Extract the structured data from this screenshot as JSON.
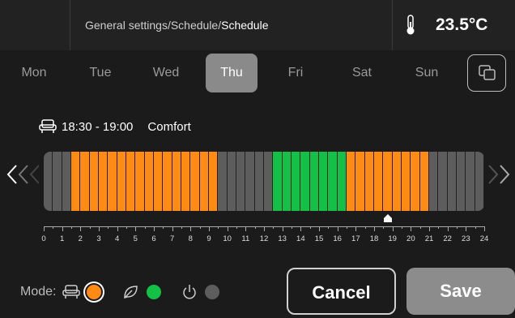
{
  "header": {
    "breadcrumb_path": "General settings/Schedule/",
    "breadcrumb_current": "Schedule",
    "temperature": "23.5°C"
  },
  "days": [
    "Mon",
    "Tue",
    "Wed",
    "Thu",
    "Fri",
    "Sat",
    "Sun"
  ],
  "active_day": "Thu",
  "selected_slot": {
    "time": "18:30 - 19:00",
    "mode": "Comfort"
  },
  "schedule": {
    "slots_per_day": 48,
    "comfort_ranges": [
      [
        1.5,
        9.5
      ],
      [
        16.5,
        21.0
      ]
    ],
    "eco_ranges": [
      [
        12.5,
        16.5
      ]
    ],
    "marker_hour": 18.75
  },
  "hours": [
    "0",
    "1",
    "2",
    "3",
    "4",
    "5",
    "6",
    "7",
    "8",
    "9",
    "10",
    "11",
    "12",
    "13",
    "14",
    "15",
    "16",
    "17",
    "18",
    "19",
    "20",
    "21",
    "22",
    "23",
    "24"
  ],
  "mode_bar": {
    "label": "Mode:"
  },
  "colors": {
    "comfort": "#ff8a14",
    "eco": "#14c046",
    "off": "#5d5d5d",
    "comfort_icon": "armchair-icon",
    "eco_icon": "leaf-icon",
    "off_icon": "power-icon"
  },
  "actions": {
    "cancel": "Cancel",
    "save": "Save"
  }
}
